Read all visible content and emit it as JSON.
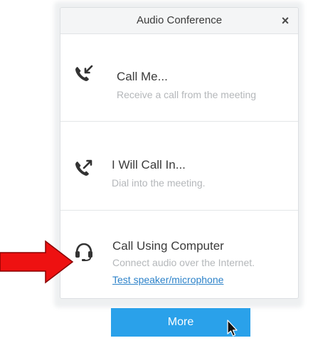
{
  "dialog": {
    "title": "Audio Conference",
    "close_label": "×"
  },
  "options": [
    {
      "title": "Call Me...",
      "description": "Receive a call from the meeting",
      "icon": "call-incoming-icon"
    },
    {
      "title": "I Will Call In...",
      "description": "Dial into the meeting.",
      "icon": "call-outgoing-icon"
    },
    {
      "title": "Call Using Computer",
      "description": "Connect audio over the Internet.",
      "link": "Test speaker/microphone",
      "icon": "headset-icon"
    }
  ],
  "more_button": {
    "label": "More"
  },
  "colors": {
    "accent": "#2aa1ea",
    "link": "#2c82c9",
    "arrow": "#ee1111"
  }
}
